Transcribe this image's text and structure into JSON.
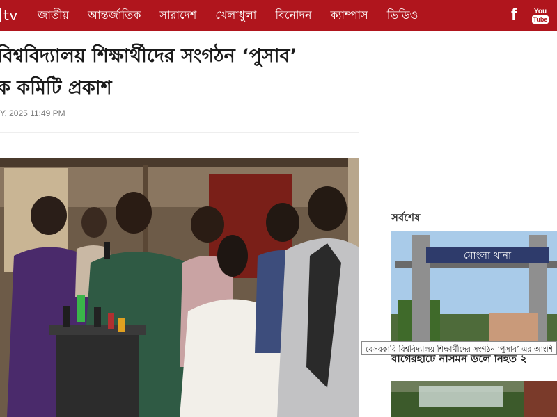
{
  "header": {
    "logo_text": "tv",
    "nav": [
      {
        "label": "জাতীয়"
      },
      {
        "label": "আন্তর্জাতিক"
      },
      {
        "label": "সারাদেশ"
      },
      {
        "label": "খেলাধুলা"
      },
      {
        "label": "বিনোদন"
      },
      {
        "label": "ক্যাম্পাস"
      },
      {
        "label": "ভিডিও"
      }
    ],
    "facebook_glyph": "f",
    "youtube_you": "You",
    "youtube_tube": "Tube",
    "brand_color": "#b0151d"
  },
  "article": {
    "title_line1": "বিশ্ববিদ্যালয় শিক্ষার্থীদের সংগঠন ‘পুসাব’",
    "title_line2": "ক কমিটি প্রকাশ",
    "date": "Y, 2025 11:49 PM"
  },
  "sidebar": {
    "section_title": "সর্বশেষ",
    "sign_text": "মোংলা থানা",
    "tooltip": "বেসরকারি বিশ্ববিদ্যালয় শিক্ষার্থীদের সংগঠন ‘পুসাব’ এর আংশি",
    "news_item_1": "বাগেরহাটে নাসমন ডলে নিহত ২"
  }
}
